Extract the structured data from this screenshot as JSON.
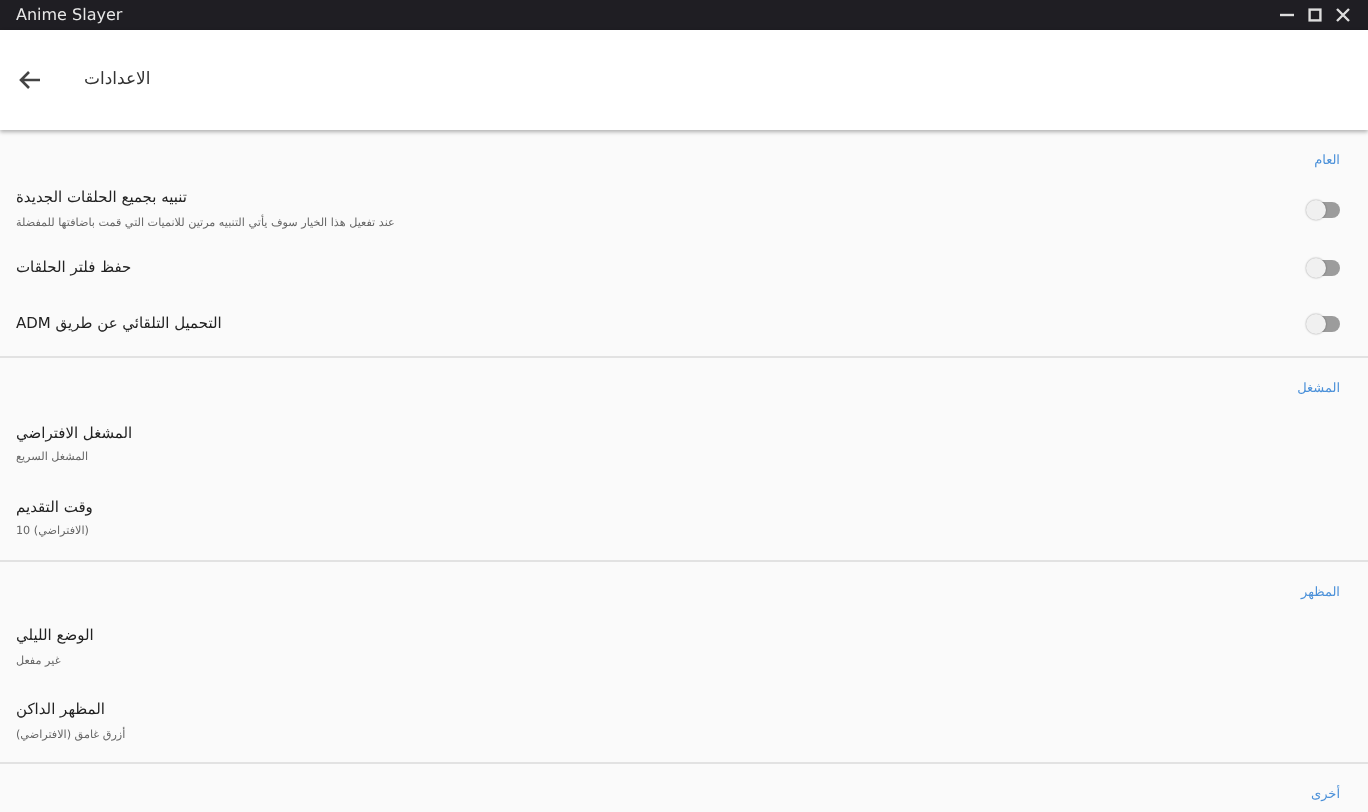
{
  "window": {
    "title": "Anime Slayer"
  },
  "toolbar": {
    "title": "الاعدادات"
  },
  "sections": [
    {
      "header": "العام",
      "items": [
        {
          "kind": "toggle",
          "title": "تنبيه بجميع الحلقات الجديدة",
          "subtitle": "عند تفعيل هذا الخيار سوف يأتي التنبيه مرتين للانميات التي قمت باضافتها للمفضلة",
          "on": false
        },
        {
          "kind": "toggle",
          "title": "حفظ فلتر الحلقات",
          "on": false
        },
        {
          "kind": "toggle",
          "title": "التحميل التلقائي عن طريق ADM",
          "on": false
        }
      ]
    },
    {
      "header": "المشغل",
      "items": [
        {
          "kind": "text",
          "title": "المشغل الافتراضي",
          "subtitle": "المشغل السريع"
        },
        {
          "kind": "text",
          "title": "وقت التقديم",
          "subtitle": "(الافتراضي) 10"
        }
      ]
    },
    {
      "header": "المظهر",
      "items": [
        {
          "kind": "text",
          "title": "الوضع الليلي",
          "subtitle": "غير مفعل"
        },
        {
          "kind": "text",
          "title": "المظهر الداكن",
          "subtitle": "أزرق غامق (الافتراضي)"
        }
      ]
    },
    {
      "header": "أخرى"
    }
  ]
}
